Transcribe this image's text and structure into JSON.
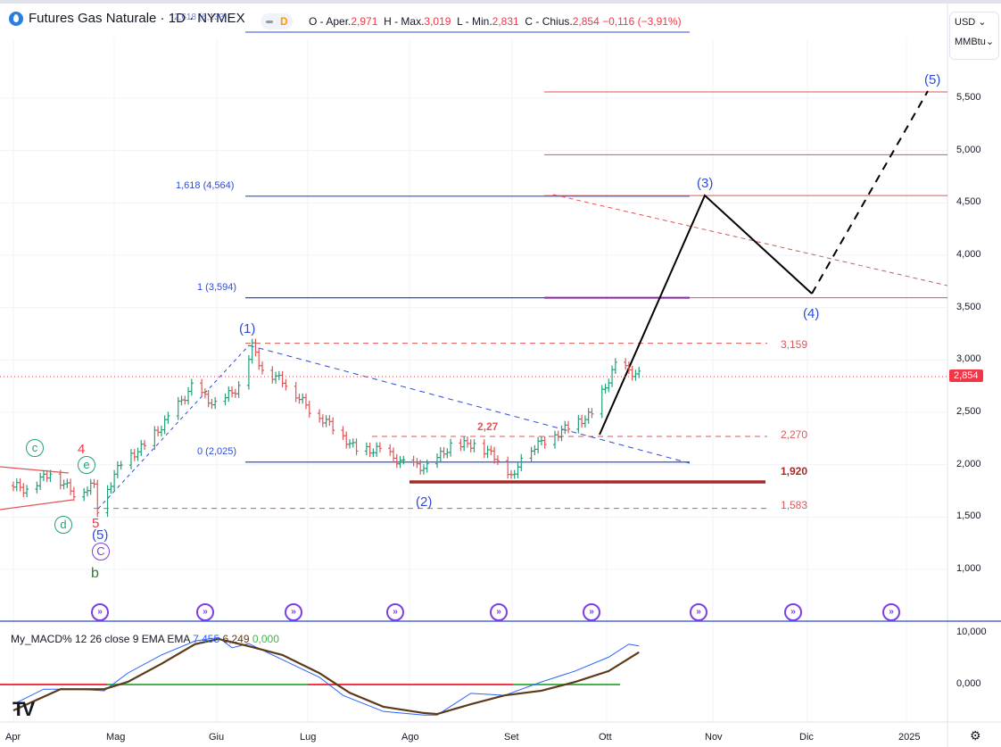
{
  "header": {
    "title": "Futures Gas Naturale · 1D · NYMEX",
    "hidden_fib_label": "2,618 (6,133)",
    "interval_badge": "D",
    "open_label": "O - Aper.",
    "open": "2,971",
    "high_label": "H - Max.",
    "high": "3,019",
    "low_label": "L - Min.",
    "low": "2,831",
    "close_label": "C - Chius.",
    "close": "2,854",
    "change": "−0,116 (−3,91%)"
  },
  "currency": "USD",
  "unit": "MMBtu",
  "last_price_tag": "2,854",
  "colors": {
    "up": "#22a078",
    "down": "#e05656",
    "fib": "#2f4bd6",
    "red_level": "#e05656",
    "support": "#a52a2a",
    "macd": "#2962ff",
    "signal": "#5d3a1a",
    "zero_pos": "#4caf50",
    "zero_neg": "#f23645",
    "accent": "#f23645"
  },
  "annotations": {
    "fib": [
      {
        "label": "1,618 (4,564)",
        "value": 4.564
      },
      {
        "label": "1 (3,594)",
        "value": 3.594
      },
      {
        "label": "0 (2,025)",
        "value": 2.025
      }
    ],
    "levels": [
      {
        "label": "3,159",
        "value": 3.159
      },
      {
        "label": "2,270",
        "value": 2.27
      },
      {
        "label": "1,920",
        "value": 1.92
      },
      {
        "label": "1,583",
        "value": 1.583
      }
    ],
    "mid_label": "2,27",
    "waves": [
      "(1)",
      "(2)",
      "(3)",
      "(4)",
      "(5)"
    ],
    "minor": {
      "c": "c",
      "d": "d",
      "e": "e",
      "four": "4",
      "five": "5",
      "five_blue": "(5)",
      "C": "C",
      "b": "b"
    }
  },
  "event_icon": "calendar-event-icon",
  "chart_data": [
    {
      "type": "ohlc",
      "title": "Futures Gas Naturale · 1D · NYMEX",
      "ylabel": "USD/MMBtu",
      "ylim": [
        0.6,
        5.9
      ],
      "y_ticks": [
        "5,500",
        "5,000",
        "4,500",
        "4,000",
        "3,500",
        "3,000",
        "2,500",
        "2,000",
        "1,500",
        "1,000"
      ],
      "x_ticks": [
        "Apr",
        "Mag",
        "Giu",
        "Lug",
        "Ago",
        "Set",
        "Ott",
        "Nov",
        "Dic",
        "2025"
      ],
      "grid": true,
      "close_series": [
        [
          "2024-04-01",
          1.8
        ],
        [
          "2024-04-05",
          1.76
        ],
        [
          "2024-04-12",
          1.93
        ],
        [
          "2024-04-19",
          1.73
        ],
        [
          "2024-04-25",
          1.8
        ],
        [
          "2024-04-26",
          1.58
        ],
        [
          "2024-05-03",
          2.02
        ],
        [
          "2024-05-10",
          2.18
        ],
        [
          "2024-05-17",
          2.44
        ],
        [
          "2024-05-24",
          2.74
        ],
        [
          "2024-05-31",
          2.57
        ],
        [
          "2024-06-07",
          2.74
        ],
        [
          "2024-06-11",
          3.13
        ],
        [
          "2024-06-14",
          2.91
        ],
        [
          "2024-06-21",
          2.78
        ],
        [
          "2024-06-28",
          2.53
        ],
        [
          "2024-07-05",
          2.36
        ],
        [
          "2024-07-12",
          2.14
        ],
        [
          "2024-07-19",
          2.14
        ],
        [
          "2024-07-26",
          2.01
        ],
        [
          "2024-08-02",
          1.97
        ],
        [
          "2024-08-09",
          2.18
        ],
        [
          "2024-08-16",
          2.2
        ],
        [
          "2024-08-23",
          2.06
        ],
        [
          "2024-08-28",
          1.87
        ],
        [
          "2024-08-30",
          2.1
        ],
        [
          "2024-09-06",
          2.23
        ],
        [
          "2024-09-13",
          2.36
        ],
        [
          "2024-09-20",
          2.48
        ],
        [
          "2024-09-27",
          2.95
        ],
        [
          "2024-10-04",
          2.854
        ]
      ]
    },
    {
      "type": "line",
      "title": "My_MACD% 12 26 close 9 EMA EMA",
      "values_label": {
        "macd": "7,455",
        "signal": "6,249",
        "zero": "0,000"
      },
      "y_ticks": [
        "10,000",
        "0,000"
      ],
      "series": [
        {
          "name": "MACD",
          "points": [
            [
              "2024-04-01",
              -3.8
            ],
            [
              "2024-04-10",
              -0.9
            ],
            [
              "2024-04-20",
              -0.9
            ],
            [
              "2024-04-28",
              -1.2
            ],
            [
              "2024-05-05",
              2.2
            ],
            [
              "2024-05-15",
              5.7
            ],
            [
              "2024-05-25",
              8.4
            ],
            [
              "2024-06-01",
              9.1
            ],
            [
              "2024-06-05",
              7.1
            ],
            [
              "2024-06-10",
              7.9
            ],
            [
              "2024-06-20",
              4.8
            ],
            [
              "2024-07-01",
              1.4
            ],
            [
              "2024-07-08",
              -2.1
            ],
            [
              "2024-07-20",
              -5.2
            ],
            [
              "2024-08-01",
              -5.9
            ],
            [
              "2024-08-05",
              -5.9
            ],
            [
              "2024-08-15",
              -1.7
            ],
            [
              "2024-08-25",
              -2.1
            ],
            [
              "2024-09-05",
              0.5
            ],
            [
              "2024-09-15",
              2.6
            ],
            [
              "2024-09-25",
              5.3
            ],
            [
              "2024-10-01",
              7.8
            ],
            [
              "2024-10-04",
              7.455
            ]
          ]
        },
        {
          "name": "Signal",
          "points": [
            [
              "2024-04-01",
              -5.0
            ],
            [
              "2024-04-15",
              -0.9
            ],
            [
              "2024-04-28",
              -0.9
            ],
            [
              "2024-05-05",
              0.5
            ],
            [
              "2024-05-15",
              4.0
            ],
            [
              "2024-05-25",
              7.8
            ],
            [
              "2024-06-01",
              8.8
            ],
            [
              "2024-06-10",
              7.4
            ],
            [
              "2024-06-20",
              5.7
            ],
            [
              "2024-07-01",
              2.2
            ],
            [
              "2024-07-10",
              -1.6
            ],
            [
              "2024-07-20",
              -4.3
            ],
            [
              "2024-08-01",
              -5.5
            ],
            [
              "2024-08-05",
              -5.7
            ],
            [
              "2024-08-15",
              -3.8
            ],
            [
              "2024-08-25",
              -2.1
            ],
            [
              "2024-09-05",
              -1.2
            ],
            [
              "2024-09-15",
              0.5
            ],
            [
              "2024-09-25",
              2.6
            ],
            [
              "2024-10-04",
              6.249
            ]
          ]
        }
      ]
    }
  ]
}
